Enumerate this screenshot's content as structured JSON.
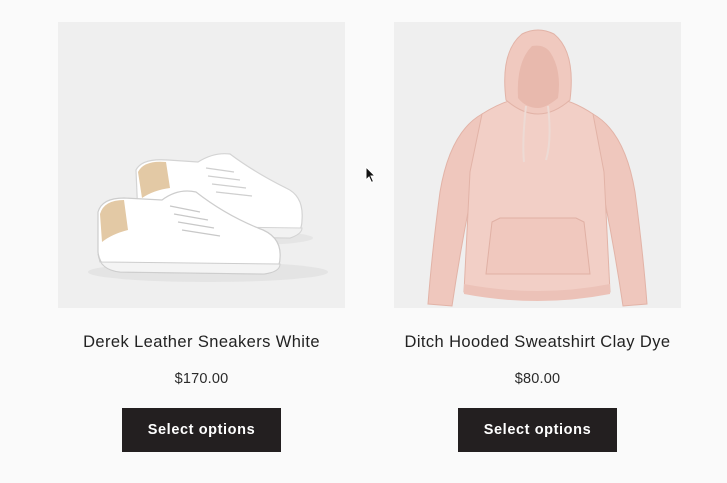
{
  "products": [
    {
      "name": "Derek Leather Sneakers White",
      "price": "$170.00",
      "button_label": "Select options"
    },
    {
      "name": "Ditch Hooded Sweatshirt Clay Dye",
      "price": "$80.00",
      "button_label": "Select options"
    }
  ],
  "colors": {
    "page_background": "#fafafa",
    "image_background": "#efefef",
    "button_background": "#231f20",
    "button_text": "#ffffff",
    "hoodie": "#f2cfc6"
  }
}
